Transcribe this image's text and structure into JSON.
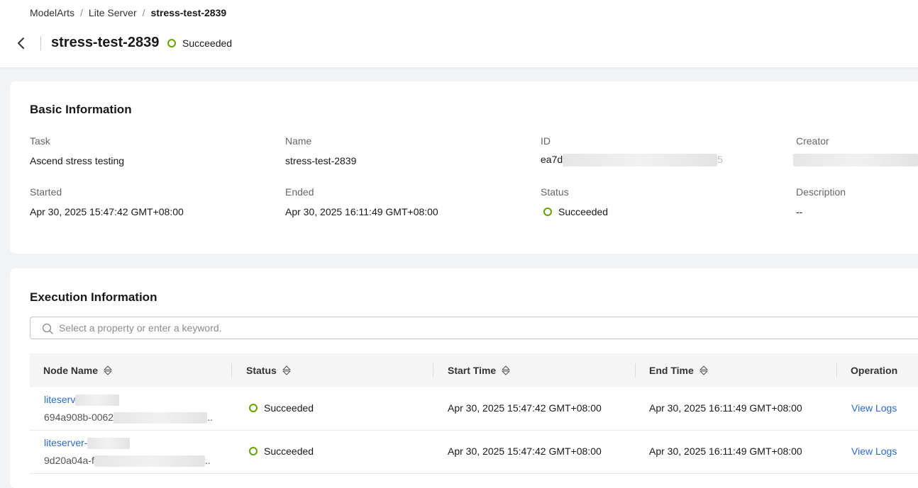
{
  "breadcrumb": {
    "root": "ModelArts",
    "parent": "Lite Server",
    "current": "stress-test-2839"
  },
  "header": {
    "title": "stress-test-2839",
    "status": "Succeeded"
  },
  "basic_info": {
    "title": "Basic Information",
    "task": {
      "label": "Task",
      "value": "Ascend stress testing"
    },
    "name": {
      "label": "Name",
      "value": "stress-test-2839"
    },
    "id": {
      "label": "ID",
      "value": "ea7d",
      "suffix": "5"
    },
    "creator": {
      "label": "Creator"
    },
    "started": {
      "label": "Started",
      "value": "Apr 30, 2025 15:47:42 GMT+08:00"
    },
    "ended": {
      "label": "Ended",
      "value": "Apr 30, 2025 16:11:49 GMT+08:00"
    },
    "status": {
      "label": "Status",
      "value": "Succeeded"
    },
    "description": {
      "label": "Description",
      "value": "--"
    }
  },
  "execution_info": {
    "title": "Execution Information",
    "search_placeholder": "Select a property or enter a keyword.",
    "columns": [
      "Node Name",
      "Status",
      "Start Time",
      "End Time",
      "Operation"
    ],
    "rows": [
      {
        "node_name": "liteserv",
        "node_id": "694a908b-0062",
        "node_id_tail": "..",
        "status": "Succeeded",
        "start_time": "Apr 30, 2025 15:47:42 GMT+08:00",
        "end_time": "Apr 30, 2025 16:11:49 GMT+08:00",
        "operation": "View Logs"
      },
      {
        "node_name": "liteserver-",
        "node_id": "9d20a04a-f",
        "node_id_tail": "..",
        "status": "Succeeded",
        "start_time": "Apr 30, 2025 15:47:42 GMT+08:00",
        "end_time": "Apr 30, 2025 16:11:49 GMT+08:00",
        "operation": "View Logs"
      }
    ]
  },
  "colors": {
    "success": "#64a200",
    "link": "#2a6ad1",
    "page_bg": "#f2f3f5"
  }
}
